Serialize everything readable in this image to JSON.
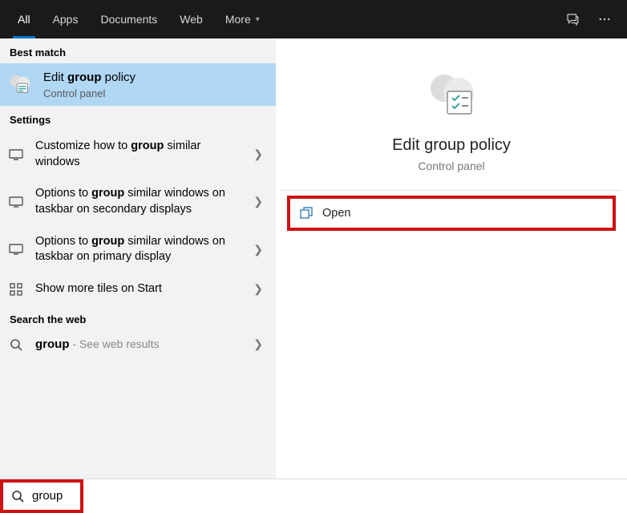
{
  "tabs": {
    "all": "All",
    "apps": "Apps",
    "documents": "Documents",
    "web": "Web",
    "more": "More"
  },
  "sections": {
    "best_match": "Best match",
    "settings": "Settings",
    "search_web": "Search the web"
  },
  "best_match": {
    "pre": "Edit ",
    "bold": "group",
    "post": " policy",
    "sub": "Control panel"
  },
  "settings_items": [
    {
      "pre": "Customize how to ",
      "bold": "group",
      "post": " similar windows"
    },
    {
      "pre": "Options to ",
      "bold": "group",
      "post": " similar windows on taskbar on secondary displays"
    },
    {
      "pre": "Options to ",
      "bold": "group",
      "post": " similar windows on taskbar on primary display"
    },
    {
      "pre": "Show more tiles on Start",
      "bold": "",
      "post": ""
    }
  ],
  "web": {
    "bold": "group",
    "suffix": " - See web results"
  },
  "detail": {
    "title": "Edit group policy",
    "sub": "Control panel",
    "open": "Open"
  },
  "search": {
    "value": "group"
  }
}
